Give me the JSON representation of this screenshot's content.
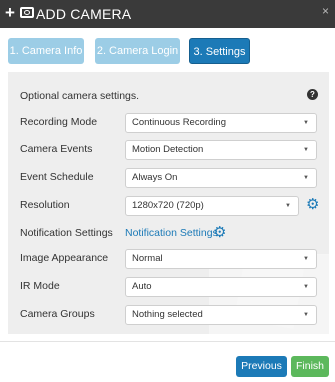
{
  "window": {
    "title": "ADD CAMERA",
    "close": "×"
  },
  "tabs": [
    {
      "label": "1. Camera Info"
    },
    {
      "label": "2. Camera Login"
    },
    {
      "label": "3. Settings"
    }
  ],
  "settings": {
    "intro": "Optional camera settings.",
    "help_icon_glyph": "?",
    "recording_mode": {
      "label": "Recording Mode",
      "value": "Continuous Recording"
    },
    "camera_events": {
      "label": "Camera Events",
      "value": "Motion Detection"
    },
    "event_schedule": {
      "label": "Event Schedule",
      "value": "Always On"
    },
    "resolution": {
      "label": "Resolution",
      "value": "1280x720 (720p)"
    },
    "notification": {
      "label": "Notification Settings",
      "link": "Notification Settings"
    },
    "image_appearance": {
      "label": "Image Appearance",
      "value": "Normal"
    },
    "ir_mode": {
      "label": "IR Mode",
      "value": "Auto"
    },
    "camera_groups": {
      "label": "Camera Groups",
      "value": "Nothing selected"
    }
  },
  "footer": {
    "previous_label": "Previous",
    "finish_label": "Finish"
  },
  "colors": {
    "primary": "#1c7ab7",
    "tab_inactive": "#9ccde6",
    "finish": "#5cb85c",
    "titlebar": "#3a3a3a"
  }
}
